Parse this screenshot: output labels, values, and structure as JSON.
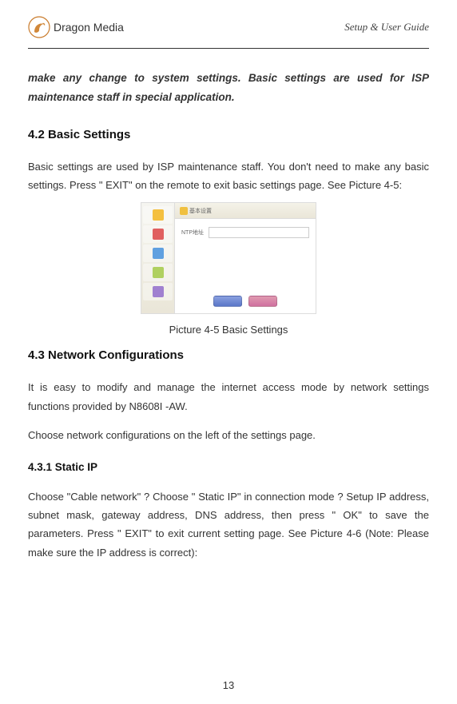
{
  "header": {
    "brand": "Dragon Media",
    "right": "Setup & User Guide"
  },
  "intro": "make any change to system settings. Basic settings are used for ISP maintenance staff in special application.",
  "s42": {
    "heading": "4.2 Basic Settings",
    "body": "Basic settings are used by ISP maintenance staff.  You don't need to make any basic settings. Press \" EXIT\"  on the remote to exit basic settings page. See Picture 4-5:",
    "caption": "Picture 4-5 Basic Settings"
  },
  "s43": {
    "heading": "4.3 Network Configurations",
    "body1": "It is easy to modify and manage the internet access mode by network settings functions provided by N8608I -AW.",
    "body2": "Choose network configurations on the left of the settings page."
  },
  "s431": {
    "heading": "4.3.1 Static IP",
    "body": "Choose \"Cable network\"  ?  Choose \" Static IP\" in connection mode  ?   Setup IP address, subnet mask,  gateway address,  DNS address, then press \" OK\"  to save the parameters. Press \" EXIT\" to exit current setting page. See Picture 4-6 (Note: Please make sure the IP address is correct):"
  },
  "pagenum": "13"
}
